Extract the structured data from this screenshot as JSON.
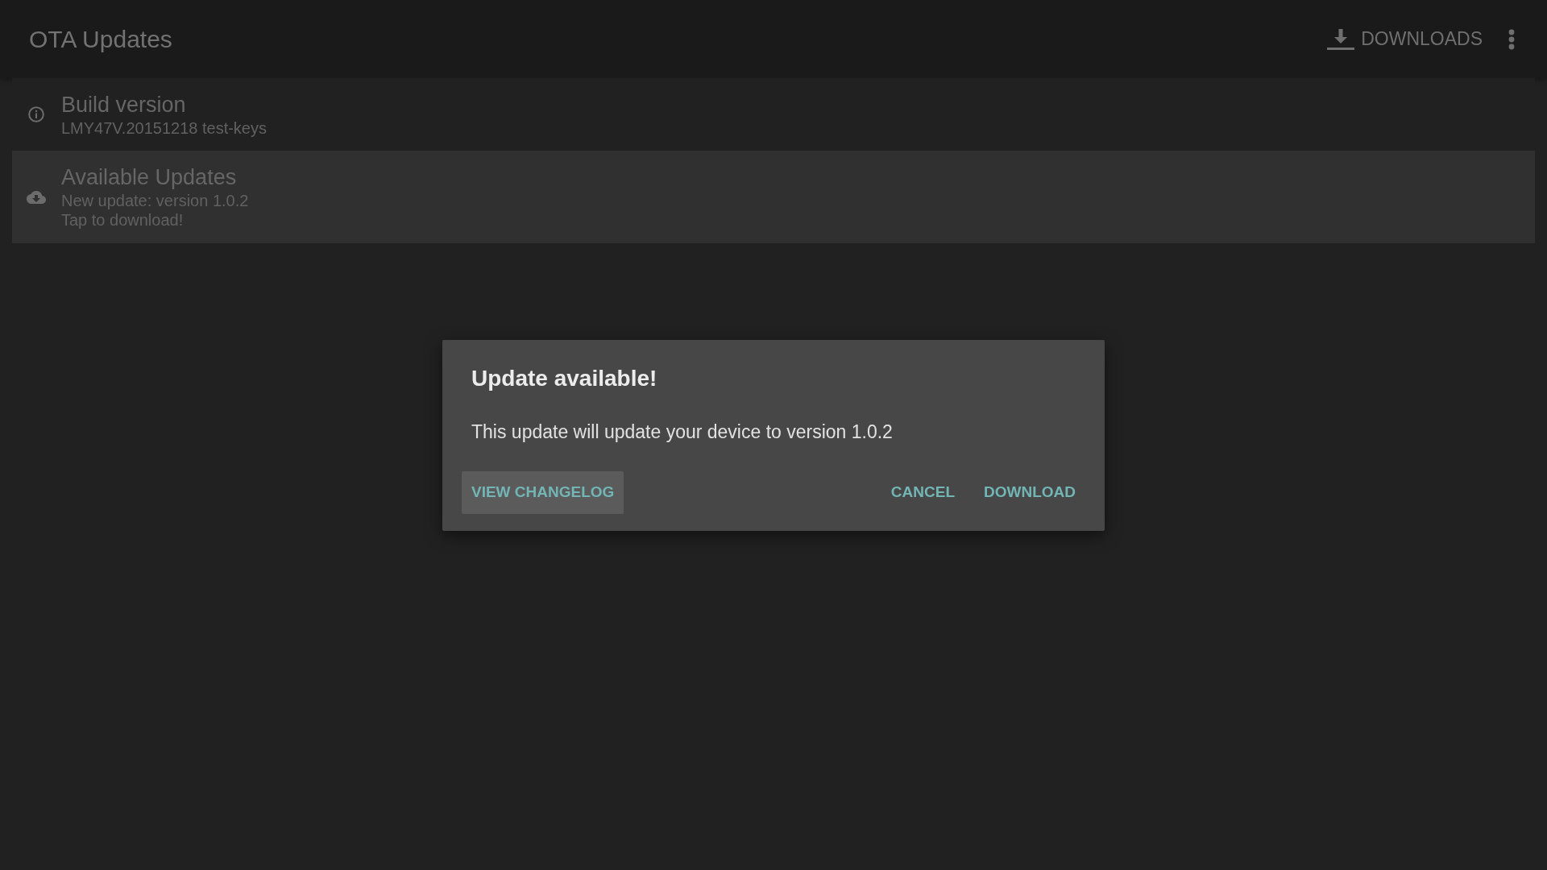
{
  "app_bar": {
    "title": "OTA Updates",
    "downloads_button": {
      "label": "DOWNLOADS"
    }
  },
  "list": {
    "items": [
      {
        "kind": "info",
        "title": "Build version",
        "summary": "LMY47V.20151218 test-keys",
        "selected": false
      },
      {
        "kind": "update",
        "title": "Available Updates",
        "summary": "New update: version 1.0.2\nTap to download!",
        "selected": true
      }
    ]
  },
  "dialog": {
    "title": "Update available!",
    "message": "This update will update your device to version 1.0.2",
    "buttons": [
      {
        "label": "VIEW CHANGELOG",
        "focused": true
      },
      {
        "label": "CANCEL",
        "focused": false
      },
      {
        "label": "DOWNLOAD",
        "focused": false
      }
    ]
  }
}
